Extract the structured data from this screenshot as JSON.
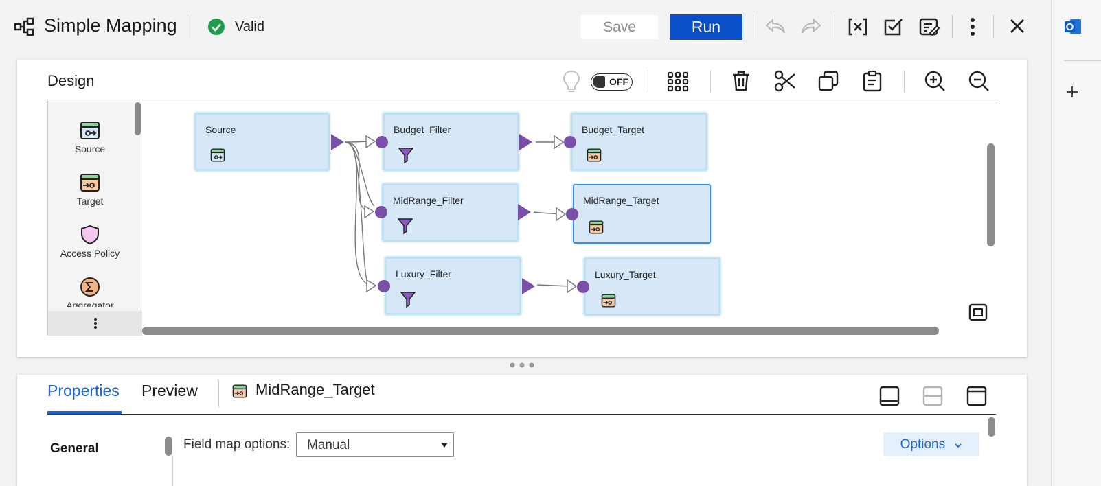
{
  "header": {
    "title": "Simple Mapping",
    "status": "Valid",
    "save_label": "Save",
    "run_label": "Run"
  },
  "design": {
    "title": "Design",
    "toggle_label": "OFF"
  },
  "palette": {
    "items": [
      {
        "label": "Source",
        "icon": "source-icon"
      },
      {
        "label": "Target",
        "icon": "target-icon"
      },
      {
        "label": "Access Policy",
        "icon": "shield-icon"
      },
      {
        "label": "Aggregator",
        "icon": "sigma-icon"
      }
    ]
  },
  "canvas": {
    "nodes": {
      "source": "Source",
      "budget_filter": "Budget_Filter",
      "budget_target": "Budget_Target",
      "midrange_filter": "MidRange_Filter",
      "midrange_target": "MidRange_Target",
      "luxury_filter": "Luxury_Filter",
      "luxury_target": "Luxury_Target"
    },
    "selected": "MidRange_Target"
  },
  "properties": {
    "tabs": [
      "Properties",
      "Preview"
    ],
    "object_name": "MidRange_Target",
    "section": "General",
    "field_map_label": "Field map options:",
    "field_map_value": "Manual",
    "options_label": "Options"
  },
  "colors": {
    "accent": "#0b4fc7",
    "tab_active": "#1a66d2",
    "node_fill": "#d6e7f8",
    "port": "#7a4fa8",
    "valid": "#1e9e4a"
  }
}
